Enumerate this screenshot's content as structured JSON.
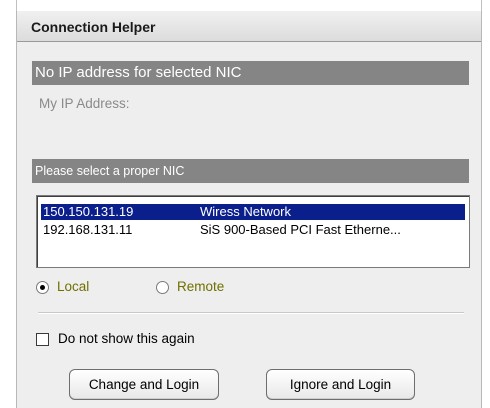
{
  "window": {
    "title": "Connection Helper"
  },
  "ip_section": {
    "status_banner": "No IP address for selected NIC",
    "my_ip_label": "My IP Address:"
  },
  "nic_section": {
    "banner": "Please select a proper NIC",
    "items": [
      {
        "ip": "150.150.131.19",
        "name": "Wiress Network",
        "selected": true
      },
      {
        "ip": "192.168.131.11",
        "name": "SiS 900-Based PCI Fast Etherne...",
        "selected": false
      }
    ]
  },
  "mode": {
    "options": [
      {
        "label": "Local",
        "checked": true
      },
      {
        "label": "Remote",
        "checked": false
      }
    ]
  },
  "dont_show": {
    "label": "Do not show this again",
    "checked": false
  },
  "buttons": {
    "change_login": "Change and Login",
    "ignore_login": "Ignore and Login"
  },
  "colors": {
    "banner_bg": "#858585",
    "selection_bg": "#0a1e8c",
    "radio_label": "#6f6f00",
    "dialog_bg": "#eeeeee"
  }
}
